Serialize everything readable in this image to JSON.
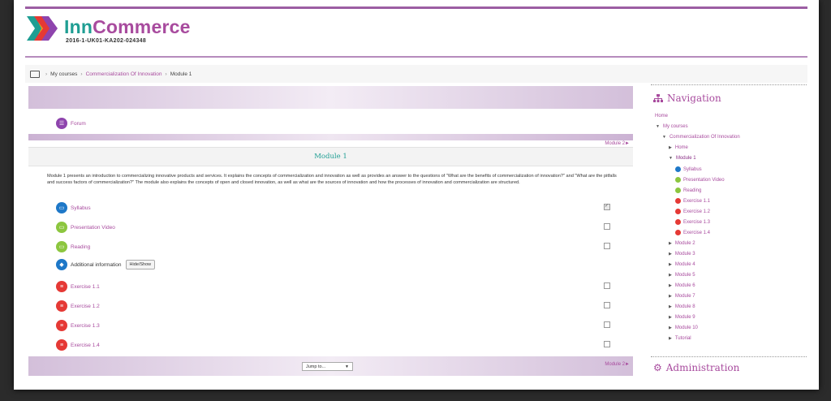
{
  "brand": {
    "name_part1": "Inn",
    "name_part2": "Commerce",
    "subtitle": "2016-1-UK01-KA202-024348"
  },
  "breadcrumb": {
    "sep": "›",
    "items": [
      "My courses",
      "Commercialization Of Innovation",
      "Module 1"
    ]
  },
  "forum": {
    "label": "Forum",
    "icon": "forum-icon"
  },
  "nav_next_top": "Module 2►",
  "module": {
    "title": "Module 1",
    "summary": "Module 1 presents an introduction to commercializing innovative products and services. It explains the concepts of commercialization and innovation as well as provides an answer to the questions of \"What are the benefits of commercialization of innovation?\" and \"What are the pitfalls and success factors of commercialization?\" The module also explains the concepts of open and closed innovation, as well as what are the sources of innovation and how the processes of innovation and commercialization are structured.",
    "activities": [
      {
        "label": "Syllabus",
        "color": "#1e78c8",
        "icon": "page-icon",
        "checked": true
      },
      {
        "label": "Presentation Video",
        "color": "#8cc63f",
        "icon": "monitor-icon",
        "checked": false
      },
      {
        "label": "Reading",
        "color": "#8cc63f",
        "icon": "monitor-icon",
        "checked": false
      },
      {
        "label": "Exercise 1.1",
        "color": "#e53935",
        "icon": "list-icon",
        "checked": false
      },
      {
        "label": "Exercise 1.2",
        "color": "#e53935",
        "icon": "list-icon",
        "checked": false
      },
      {
        "label": "Exercise 1.3",
        "color": "#e53935",
        "icon": "list-icon",
        "checked": false
      },
      {
        "label": "Exercise 1.4",
        "color": "#e53935",
        "icon": "list-icon",
        "checked": false
      }
    ],
    "additional": {
      "label": "Additional information",
      "button": "Hide/Show",
      "color": "#1e78c8",
      "icon": "tag-icon"
    }
  },
  "footer": {
    "jump_placeholder": "Jump to...",
    "next": "Module 2►"
  },
  "navigation": {
    "title": "Navigation",
    "home": "Home",
    "my_courses": "My courses",
    "course": "Commercialization Of Innovation",
    "course_home": "Home",
    "current_module": "Module 1",
    "module1_items": [
      {
        "label": "Syllabus",
        "color": "#1e78c8"
      },
      {
        "label": "Presentation Video",
        "color": "#8cc63f"
      },
      {
        "label": "Reading",
        "color": "#8cc63f"
      },
      {
        "label": "Exercise 1.1",
        "color": "#e53935"
      },
      {
        "label": "Exercise 1.2",
        "color": "#e53935"
      },
      {
        "label": "Exercise 1.3",
        "color": "#e53935"
      },
      {
        "label": "Exercise 1.4",
        "color": "#e53935"
      }
    ],
    "other_modules": [
      "Module 2",
      "Module 3",
      "Module 4",
      "Module 5",
      "Module 6",
      "Module 7",
      "Module 8",
      "Module 9",
      "Module 10",
      "Tutorial"
    ]
  },
  "administration": {
    "title": "Administration"
  }
}
